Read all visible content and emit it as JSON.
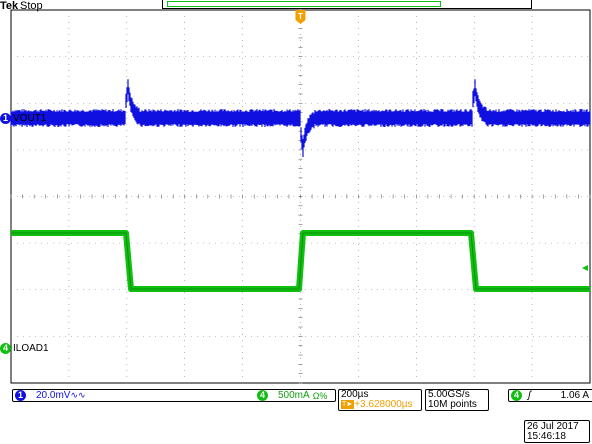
{
  "header": {
    "brand": "Tek",
    "state": "Stop"
  },
  "channels": {
    "ch1": {
      "number": "1",
      "label": "VOUT1",
      "scale": "20.0mV",
      "coupling_icon": "∿∿",
      "color": "#1010e0"
    },
    "ch4": {
      "number": "4",
      "label": "ILOAD1",
      "scale": "500mA",
      "coupling_icon": "Ω%",
      "color": "#10c010"
    }
  },
  "trigger_marker": {
    "label": "T",
    "color": "#f0a000"
  },
  "timebase": {
    "scale": "200µs",
    "trigger_pos": "+3.628000µs",
    "trigger_icon": "T►"
  },
  "acquisition": {
    "sample_rate": "5.00GS/s",
    "record_length": "10M points"
  },
  "trigger": {
    "source": "4",
    "slope_icon": "ʃ",
    "level": "1.06 A"
  },
  "datetime": {
    "date": "26 Jul  2017",
    "time": "15:46:18"
  }
}
